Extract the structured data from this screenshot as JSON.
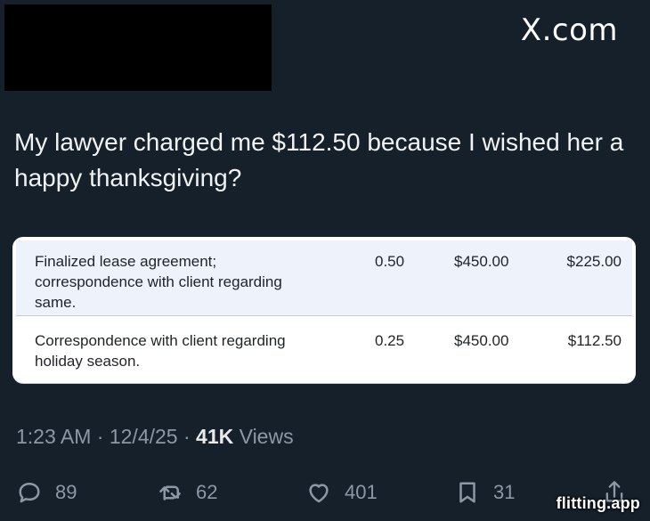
{
  "site": {
    "brand": "X.com"
  },
  "tweet": {
    "text": "My lawyer charged me $112.50 because I wished her a happy thanksgiving?",
    "meta": {
      "time": "1:23 AM",
      "date": "12/4/25",
      "views_count": "41K",
      "views_label": "Views"
    }
  },
  "invoice": {
    "rows": [
      {
        "description": "Finalized lease agreement;\ncorrespondence with client regarding\nsame.",
        "hours": "0.50",
        "rate": "$450.00",
        "amount": "$225.00"
      },
      {
        "description": "Correspondence with client regarding\nholiday season.",
        "hours": "0.25",
        "rate": "$450.00",
        "amount": "$112.50"
      }
    ]
  },
  "actions": {
    "replies": "89",
    "reposts": "62",
    "likes": "401",
    "bookmarks": "31"
  },
  "watermark": "flitting.app",
  "colors": {
    "background": "#15202b",
    "text": "#e7e9ea",
    "muted": "#8b98a5",
    "card": "#ffffff",
    "card_highlight": "#eef3fb"
  },
  "icons": {
    "reply": "reply-icon",
    "repost": "repost-icon",
    "like": "heart-icon",
    "bookmark": "bookmark-icon",
    "share": "share-icon"
  }
}
